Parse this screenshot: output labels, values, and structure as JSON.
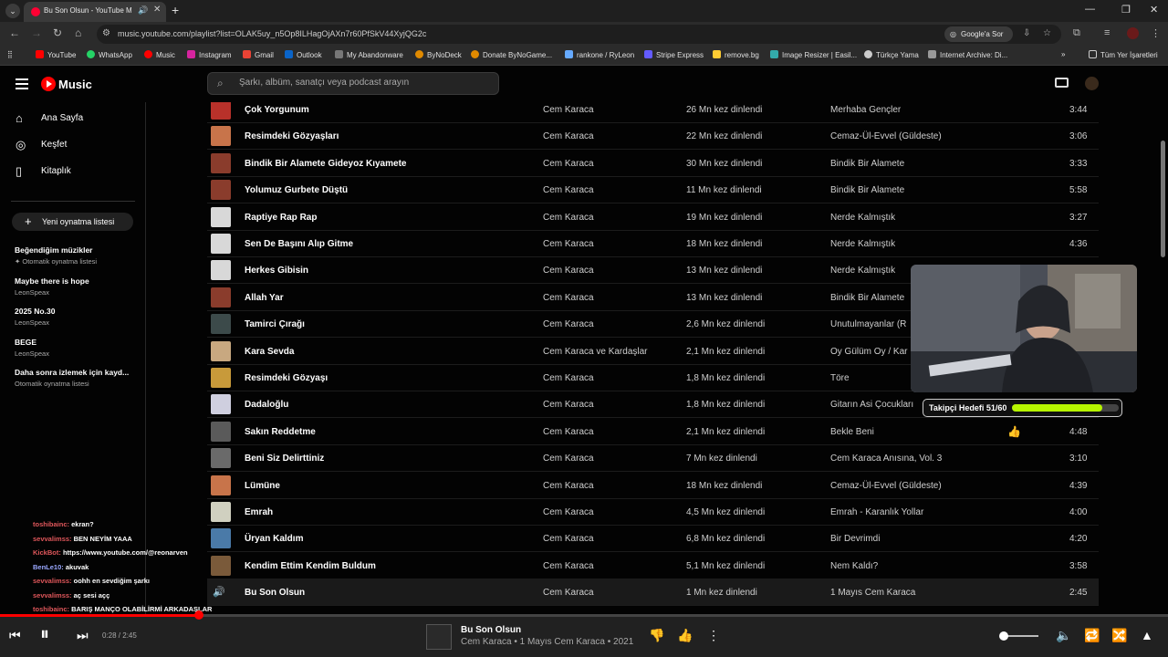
{
  "browser": {
    "tab_title": "Bu Son Olsun - YouTube M",
    "url": "music.youtube.com/playlist?list=OLAK5uy_n5Op8ILHagOjAXn7r60PfSkV44XyjQG2c",
    "google_sor": "Google'a Sor",
    "bookmarks": [
      "YouTube",
      "WhatsApp",
      "Music",
      "Instagram",
      "Gmail",
      "Outlook",
      "My Abandonware",
      "ByNoDeck",
      "Donate ByNoGame...",
      "rankone / RyLeon",
      "Stripe Express",
      "remove.bg",
      "Image Resizer | Easil...",
      "Türkçe Yama",
      "Internet Archive: Di..."
    ],
    "bookmarks_more": "»",
    "all_bookmarks": "Tüm Yer İşaretleri"
  },
  "header": {
    "logo": "Music",
    "search_placeholder": "Şarkı, albüm, sanatçı veya podcast arayın"
  },
  "sidebar": {
    "nav": [
      "Ana Sayfa",
      "Keşfet",
      "Kitaplık"
    ],
    "new_playlist": "Yeni oynatma listesi",
    "playlists": [
      {
        "title": "Beğendiğim müzikler",
        "sub": "Otomatik oynatma listesi"
      },
      {
        "title": "Maybe there is hope",
        "sub": "LeonSpeax"
      },
      {
        "title": "2025 No.30",
        "sub": "LeonSpeax"
      },
      {
        "title": "BEGE",
        "sub": "LeonSpeax"
      },
      {
        "title": "Daha sonra izlemek için kayd...",
        "sub": "Otomatik oynatma listesi"
      }
    ]
  },
  "tracks": [
    {
      "title": "Çok Yorgunum",
      "artist": "Cem Karaca",
      "plays": "26 Mn kez dinlendi",
      "album": "Merhaba Gençler",
      "duration": "3:44",
      "color": "#b8312a"
    },
    {
      "title": "Resimdeki Gözyaşları",
      "artist": "Cem Karaca",
      "plays": "22 Mn kez dinlendi",
      "album": "Cemaz-Ül-Evvel (Güldeste)",
      "duration": "3:06",
      "color": "#c8744a"
    },
    {
      "title": "Bindik Bir Alamete Gideyoz Kıyamete",
      "artist": "Cem Karaca",
      "plays": "30 Mn kez dinlendi",
      "album": "Bindik Bir Alamete",
      "duration": "3:33",
      "color": "#8a3c2c"
    },
    {
      "title": "Yolumuz Gurbete Düştü",
      "artist": "Cem Karaca",
      "plays": "11 Mn kez dinlendi",
      "album": "Bindik Bir Alamete",
      "duration": "5:58",
      "color": "#8a3c2c"
    },
    {
      "title": "Raptiye Rap Rap",
      "artist": "Cem Karaca",
      "plays": "19 Mn kez dinlendi",
      "album": "Nerde Kalmıştık",
      "duration": "3:27",
      "color": "#d8d8d8"
    },
    {
      "title": "Sen De Başını Alıp Gitme",
      "artist": "Cem Karaca",
      "plays": "18 Mn kez dinlendi",
      "album": "Nerde Kalmıştık",
      "duration": "4:36",
      "color": "#d8d8d8"
    },
    {
      "title": "Herkes Gibisin",
      "artist": "Cem Karaca",
      "plays": "13 Mn kez dinlendi",
      "album": "Nerde Kalmıştık",
      "duration": "",
      "color": "#d8d8d8"
    },
    {
      "title": "Allah Yar",
      "artist": "Cem Karaca",
      "plays": "13 Mn kez dinlendi",
      "album": "Bindik Bir Alamete",
      "duration": "",
      "color": "#8a3c2c"
    },
    {
      "title": "Tamirci Çırağı",
      "artist": "Cem Karaca",
      "plays": "2,6 Mn kez dinlendi",
      "album": "Unutulmayanlar (R",
      "duration": "",
      "color": "#3c4a4a"
    },
    {
      "title": "Kara Sevda",
      "artist": "Cem Karaca ve Kardaşlar",
      "plays": "2,1 Mn kez dinlendi",
      "album": "Oy Gülüm Oy / Kar",
      "duration": "",
      "color": "#c8a880"
    },
    {
      "title": "Resimdeki Gözyaşı",
      "artist": "Cem Karaca",
      "plays": "1,8 Mn kez dinlendi",
      "album": "Töre",
      "duration": "",
      "color": "#c89a3a"
    },
    {
      "title": "Dadaloğlu",
      "artist": "Cem Karaca",
      "plays": "1,8 Mn kez dinlendi",
      "album": "Gitarın Asi Çocukları",
      "duration": "",
      "color": "#cfcfdf"
    },
    {
      "title": "Sakın Reddetme",
      "artist": "Cem Karaca",
      "plays": "2,1 Mn kez dinlendi",
      "album": "Bekle Beni",
      "duration": "4:48",
      "color": "#5a5a5a"
    },
    {
      "title": "Beni Siz Delirttiniz",
      "artist": "Cem Karaca",
      "plays": "7 Mn kez dinlendi",
      "album": "Cem Karaca Anısına, Vol. 3",
      "duration": "3:10",
      "color": "#6a6a6a"
    },
    {
      "title": "Lümüne",
      "artist": "Cem Karaca",
      "plays": "18 Mn kez dinlendi",
      "album": "Cemaz-Ül-Evvel (Güldeste)",
      "duration": "4:39",
      "color": "#c8744a"
    },
    {
      "title": "Emrah",
      "artist": "Cem Karaca",
      "plays": "4,5 Mn kez dinlendi",
      "album": "Emrah - Karanlık Yollar",
      "duration": "4:00",
      "color": "#d0d0c0"
    },
    {
      "title": "Üryan Kaldım",
      "artist": "Cem Karaca",
      "plays": "6,8 Mn kez dinlendi",
      "album": "Bir Devrimdi",
      "duration": "4:20",
      "color": "#4a7aa8"
    },
    {
      "title": "Kendim Ettim Kendim Buldum",
      "artist": "Cem Karaca",
      "plays": "5,1 Mn kez dinlendi",
      "album": "Nem Kaldı?",
      "duration": "3:58",
      "color": "#7a5a3a"
    },
    {
      "title": "Bu Son Olsun",
      "artist": "Cem Karaca",
      "plays": "1 Mn kez dinlendi",
      "album": "1 Mayıs Cem Karaca",
      "duration": "2:45",
      "color": "#333333"
    }
  ],
  "active_track_index": 18,
  "overlay": {
    "goal_label": "Takipçi Hedefi 51/60",
    "goal_progress": 0.85,
    "goal_color": "#b6f500"
  },
  "chat": [
    {
      "user": "toshibainc:",
      "msg": "ekran?"
    },
    {
      "user": "sevvalimss:",
      "msg": "BEN NEYİM YAAA"
    },
    {
      "user": "KickBot:",
      "msg": "https://www.youtube.com/@reonarven"
    },
    {
      "user": "BenLe10:",
      "msg": "akuvak"
    },
    {
      "user": "sevvalimss:",
      "msg": "oohh en sevdiğim şarkı"
    },
    {
      "user": "sevvalimss:",
      "msg": "aç sesi açç"
    },
    {
      "user": "toshibainc:",
      "msg": "BARIŞ MANÇO OLABİLİRMİ ARKADAŞLAR"
    }
  ],
  "player": {
    "time": "0:28 / 2:45",
    "progress": 0.17,
    "title": "Bu Son Olsun",
    "subtitle": "Cem Karaca • 1 Mayıs Cem Karaca • 2021",
    "volume": 0.05
  },
  "icons": {
    "home": "home-icon",
    "explore": "compass-icon",
    "library": "library-icon",
    "search": "search-icon",
    "cast": "cast-icon"
  }
}
